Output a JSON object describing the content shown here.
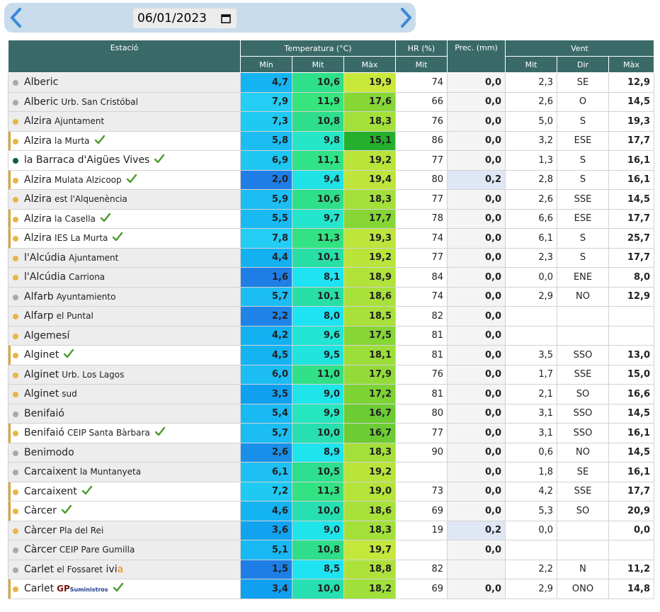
{
  "date": "06/01/2023",
  "headers": {
    "station": "Estació",
    "temperature": "Temperatura (°C)",
    "humidity": "HR (%)",
    "precipitation": "Prec. (mm)",
    "wind": "Vent",
    "t_min": "Mín",
    "t_mit": "Mit",
    "t_max": "Màx",
    "hr_mit": "Mit",
    "w_mit": "Mit",
    "w_dir": "Dir",
    "w_max": "Màx"
  },
  "dot_colors": {
    "gray": "#a9a9a9",
    "orange": "#e8b547",
    "green": "#0e5a4c"
  },
  "check_color": "#4a9a2a",
  "rows": [
    {
      "name": "Alberic",
      "sub": "",
      "dot": "gray",
      "check": false,
      "min": "4,7",
      "mit": "10,6",
      "max": "19,9",
      "hr": "74",
      "prec": "0,0",
      "wmit": "2,3",
      "dir": "SE",
      "wmax": "12,9",
      "c_min": "#14b4f2",
      "c_mit": "#2ee089",
      "c_max": "#c9e83a",
      "alt": true,
      "hl": false
    },
    {
      "name": "Alberic",
      "sub": "Urb. San Cristóbal",
      "dot": "gray",
      "check": false,
      "min": "7,9",
      "mit": "11,9",
      "max": "17,6",
      "hr": "66",
      "prec": "0,0",
      "wmit": "2,6",
      "dir": "O",
      "wmax": "14,5",
      "c_min": "#23cdf4",
      "c_mit": "#36e57c",
      "c_max": "#86d636",
      "alt": true,
      "hl": false
    },
    {
      "name": "Alzira",
      "sub": "Ajuntament",
      "dot": "orange",
      "check": false,
      "min": "7,3",
      "mit": "10,8",
      "max": "18,3",
      "hr": "76",
      "prec": "0,0",
      "wmit": "5,0",
      "dir": "S",
      "wmax": "19,3",
      "c_min": "#1fcaf2",
      "c_mit": "#2ede8a",
      "c_max": "#a4e03a",
      "alt": true,
      "hl": false
    },
    {
      "name": "Alzira",
      "sub": "la Murta",
      "dot": "orange",
      "check": true,
      "min": "5,8",
      "mit": "9,8",
      "max": "15,1",
      "hr": "86",
      "prec": "0,0",
      "wmit": "3,2",
      "dir": "ESE",
      "wmax": "17,7",
      "c_min": "#1bbdf3",
      "c_mit": "#25e7c8",
      "c_max": "#24b02c",
      "alt": false,
      "hl": true
    },
    {
      "name": "la Barraca d'Aigües Vives",
      "sub": "",
      "dot": "green",
      "check": true,
      "min": "6,9",
      "mit": "11,1",
      "max": "19,2",
      "hr": "77",
      "prec": "0,0",
      "wmit": "1,3",
      "dir": "S",
      "wmax": "16,1",
      "c_min": "#1ec6f2",
      "c_mit": "#31e286",
      "c_max": "#b9e43a",
      "alt": false,
      "hl": false
    },
    {
      "name": "Alzira",
      "sub": "Mulata Alzicoop",
      "dot": "orange",
      "check": true,
      "min": "2,0",
      "mit": "9,4",
      "max": "19,4",
      "hr": "80",
      "prec": "0,2",
      "wmit": "2,8",
      "dir": "S",
      "wmax": "16,1",
      "c_min": "#1e7ee6",
      "c_mit": "#20e3e6",
      "c_max": "#bde53b",
      "alt": false,
      "hl": true
    },
    {
      "name": "Alzira",
      "sub": "est l'Alquenència",
      "dot": "orange",
      "check": false,
      "min": "5,9",
      "mit": "10,6",
      "max": "18,3",
      "hr": "77",
      "prec": "0,0",
      "wmit": "2,6",
      "dir": "SSE",
      "wmax": "14,5",
      "c_min": "#1bbdf3",
      "c_mit": "#2ee089",
      "c_max": "#a4e03a",
      "alt": true,
      "hl": false
    },
    {
      "name": "Alzira",
      "sub": "la Casella",
      "dot": "orange",
      "check": true,
      "min": "5,5",
      "mit": "9,7",
      "max": "17,7",
      "hr": "78",
      "prec": "0,0",
      "wmit": "6,6",
      "dir": "ESE",
      "wmax": "17,7",
      "c_min": "#19baf3",
      "c_mit": "#24e6cc",
      "c_max": "#86d636",
      "alt": false,
      "hl": true
    },
    {
      "name": "Alzira",
      "sub": "IES La Murta",
      "dot": "orange",
      "check": true,
      "min": "7,8",
      "mit": "11,3",
      "max": "19,3",
      "hr": "74",
      "prec": "0,0",
      "wmit": "6,1",
      "dir": "S",
      "wmax": "25,7",
      "c_min": "#23cdf4",
      "c_mit": "#33e383",
      "c_max": "#bde53b",
      "alt": false,
      "hl": true
    },
    {
      "name": "l'Alcúdia",
      "sub": "Ajuntament",
      "dot": "orange",
      "check": false,
      "min": "4,4",
      "mit": "10,1",
      "max": "19,2",
      "hr": "77",
      "prec": "0,0",
      "wmit": "2,3",
      "dir": "S",
      "wmax": "17,7",
      "c_min": "#13b0f2",
      "c_mit": "#28dfa6",
      "c_max": "#b9e43a",
      "alt": true,
      "hl": false
    },
    {
      "name": "l'Alcúdia",
      "sub": "Carriona",
      "dot": "orange",
      "check": false,
      "min": "1,6",
      "mit": "8,1",
      "max": "18,9",
      "hr": "84",
      "prec": "0,0",
      "wmit": "0,0",
      "dir": "ENE",
      "wmax": "8,0",
      "c_min": "#1e7ee6",
      "c_mit": "#1ee3f2",
      "c_max": "#b0e23a",
      "alt": true,
      "hl": false
    },
    {
      "name": "Alfarb",
      "sub": "Ayuntamiento",
      "dot": "gray",
      "check": false,
      "min": "5,7",
      "mit": "10,1",
      "max": "18,6",
      "hr": "74",
      "prec": "0,0",
      "wmit": "2,9",
      "dir": "NO",
      "wmax": "12,9",
      "c_min": "#1bbdf3",
      "c_mit": "#28dfa6",
      "c_max": "#a8e13a",
      "alt": true,
      "hl": false
    },
    {
      "name": "Alfarp",
      "sub": "el Puntal",
      "dot": "orange",
      "check": false,
      "min": "2,2",
      "mit": "8,0",
      "max": "18,5",
      "hr": "82",
      "prec": "0,0",
      "wmit": "",
      "dir": "",
      "wmax": "",
      "c_min": "#1e84e8",
      "c_mit": "#1ee3f2",
      "c_max": "#a8e13a",
      "alt": true,
      "hl": false
    },
    {
      "name": "Algemesí",
      "sub": "",
      "dot": "orange",
      "check": false,
      "min": "4,2",
      "mit": "9,6",
      "max": "17,5",
      "hr": "81",
      "prec": "0,0",
      "wmit": "",
      "dir": "",
      "wmax": "",
      "c_min": "#13b0f2",
      "c_mit": "#22e5d6",
      "c_max": "#86d636",
      "alt": true,
      "hl": false
    },
    {
      "name": "Alginet",
      "sub": "",
      "dot": "orange",
      "check": true,
      "min": "4,5",
      "mit": "9,5",
      "max": "18,1",
      "hr": "81",
      "prec": "0,0",
      "wmit": "3,5",
      "dir": "SSO",
      "wmax": "13,0",
      "c_min": "#14b4f2",
      "c_mit": "#21e4de",
      "c_max": "#9cdf3a",
      "alt": false,
      "hl": true
    },
    {
      "name": "Alginet",
      "sub": "Urb. Los Lagos",
      "dot": "orange",
      "check": false,
      "min": "6,0",
      "mit": "11,0",
      "max": "17,9",
      "hr": "76",
      "prec": "0,0",
      "wmit": "1,7",
      "dir": "SSE",
      "wmax": "15,0",
      "c_min": "#1bbdf3",
      "c_mit": "#30e188",
      "c_max": "#92db38",
      "alt": true,
      "hl": false
    },
    {
      "name": "Alginet",
      "sub": "sud",
      "dot": "orange",
      "check": false,
      "min": "3,5",
      "mit": "9,0",
      "max": "17,2",
      "hr": "81",
      "prec": "0,0",
      "wmit": "2,1",
      "dir": "SO",
      "wmax": "16,6",
      "c_min": "#119ff0",
      "c_mit": "#1fe4ea",
      "c_max": "#7ed334",
      "alt": true,
      "hl": false
    },
    {
      "name": "Benifaió",
      "sub": "",
      "dot": "gray",
      "check": false,
      "min": "5,4",
      "mit": "9,9",
      "max": "16,7",
      "hr": "80",
      "prec": "0,0",
      "wmit": "3,1",
      "dir": "SSO",
      "wmax": "14,5",
      "c_min": "#19baf3",
      "c_mit": "#26e6c0",
      "c_max": "#6dcc33",
      "alt": true,
      "hl": false
    },
    {
      "name": "Benifaió",
      "sub": "CEIP Santa Bàrbara",
      "dot": "orange",
      "check": true,
      "min": "5,7",
      "mit": "10,0",
      "max": "16,7",
      "hr": "77",
      "prec": "0,0",
      "wmit": "3,1",
      "dir": "SSO",
      "wmax": "16,1",
      "c_min": "#1bbdf3",
      "c_mit": "#27dfb0",
      "c_max": "#6dcc33",
      "alt": false,
      "hl": true
    },
    {
      "name": "Benimodo",
      "sub": "",
      "dot": "gray",
      "check": false,
      "min": "2,6",
      "mit": "8,9",
      "max": "18,3",
      "hr": "90",
      "prec": "0,0",
      "wmit": "0,6",
      "dir": "NO",
      "wmax": "14,5",
      "c_min": "#1890ea",
      "c_mit": "#1fe4ee",
      "c_max": "#a4e03a",
      "alt": true,
      "hl": false
    },
    {
      "name": "Carcaixent",
      "sub": "la Muntanyeta",
      "dot": "gray",
      "check": false,
      "min": "6,1",
      "mit": "10,5",
      "max": "19,2",
      "hr": "",
      "prec": "0,0",
      "wmit": "1,8",
      "dir": "SE",
      "wmax": "16,1",
      "c_min": "#1ec0f3",
      "c_mit": "#2ddf8e",
      "c_max": "#b9e43a",
      "alt": true,
      "hl": false
    },
    {
      "name": "Carcaixent",
      "sub": "",
      "dot": "orange",
      "check": true,
      "min": "7,2",
      "mit": "11,3",
      "max": "19,0",
      "hr": "73",
      "prec": "0,0",
      "wmit": "4,2",
      "dir": "SSE",
      "wmax": "17,7",
      "c_min": "#1fcaf2",
      "c_mit": "#33e383",
      "c_max": "#b4e33a",
      "alt": false,
      "hl": true
    },
    {
      "name": "Càrcer",
      "sub": "",
      "dot": "orange",
      "check": true,
      "min": "4,6",
      "mit": "10,0",
      "max": "18,6",
      "hr": "69",
      "prec": "0,0",
      "wmit": "5,3",
      "dir": "SO",
      "wmax": "20,9",
      "c_min": "#14b4f2",
      "c_mit": "#27dfb0",
      "c_max": "#a8e13a",
      "alt": false,
      "hl": true
    },
    {
      "name": "Càrcer",
      "sub": "Pla del Rei",
      "dot": "orange",
      "check": false,
      "min": "3,6",
      "mit": "9,0",
      "max": "18,3",
      "hr": "19",
      "prec": "0,2",
      "wmit": "0,0",
      "dir": "",
      "wmax": "0,0",
      "c_min": "#11a2f0",
      "c_mit": "#1fe4ea",
      "c_max": "#a4e03a",
      "alt": true,
      "hl": false
    },
    {
      "name": "Càrcer",
      "sub": "CEIP Pare Gumilla",
      "dot": "gray",
      "check": false,
      "min": "5,1",
      "mit": "10,8",
      "max": "19,7",
      "hr": "",
      "prec": "0,0",
      "wmit": "",
      "dir": "",
      "wmax": "",
      "c_min": "#17b8f3",
      "c_mit": "#2ede8a",
      "c_max": "#c4e73b",
      "alt": true,
      "hl": false
    },
    {
      "name": "Carlet",
      "sub": "el Fossaret",
      "dot": "gray",
      "check": false,
      "logo": "ivia",
      "min": "1,5",
      "mit": "8,5",
      "max": "18,8",
      "hr": "82",
      "prec": "",
      "wmit": "2,2",
      "dir": "N",
      "wmax": "11,2",
      "c_min": "#1e7ee6",
      "c_mit": "#1ee3f2",
      "c_max": "#ade23a",
      "alt": true,
      "hl": false
    },
    {
      "name": "Carlet",
      "sub": "",
      "dot": "orange",
      "check": true,
      "logo": "gp",
      "min": "3,4",
      "mit": "10,0",
      "max": "18,2",
      "hr": "69",
      "prec": "0,0",
      "wmit": "2,9",
      "dir": "ONO",
      "wmax": "14,8",
      "c_min": "#119ff0",
      "c_mit": "#27dfb0",
      "c_max": "#a0e03a",
      "alt": false,
      "hl": true
    }
  ],
  "logos": {
    "ivia_text": "ivi",
    "ivia_accent": "a",
    "gp_text": "GP",
    "gp_sub": "Suministros"
  }
}
